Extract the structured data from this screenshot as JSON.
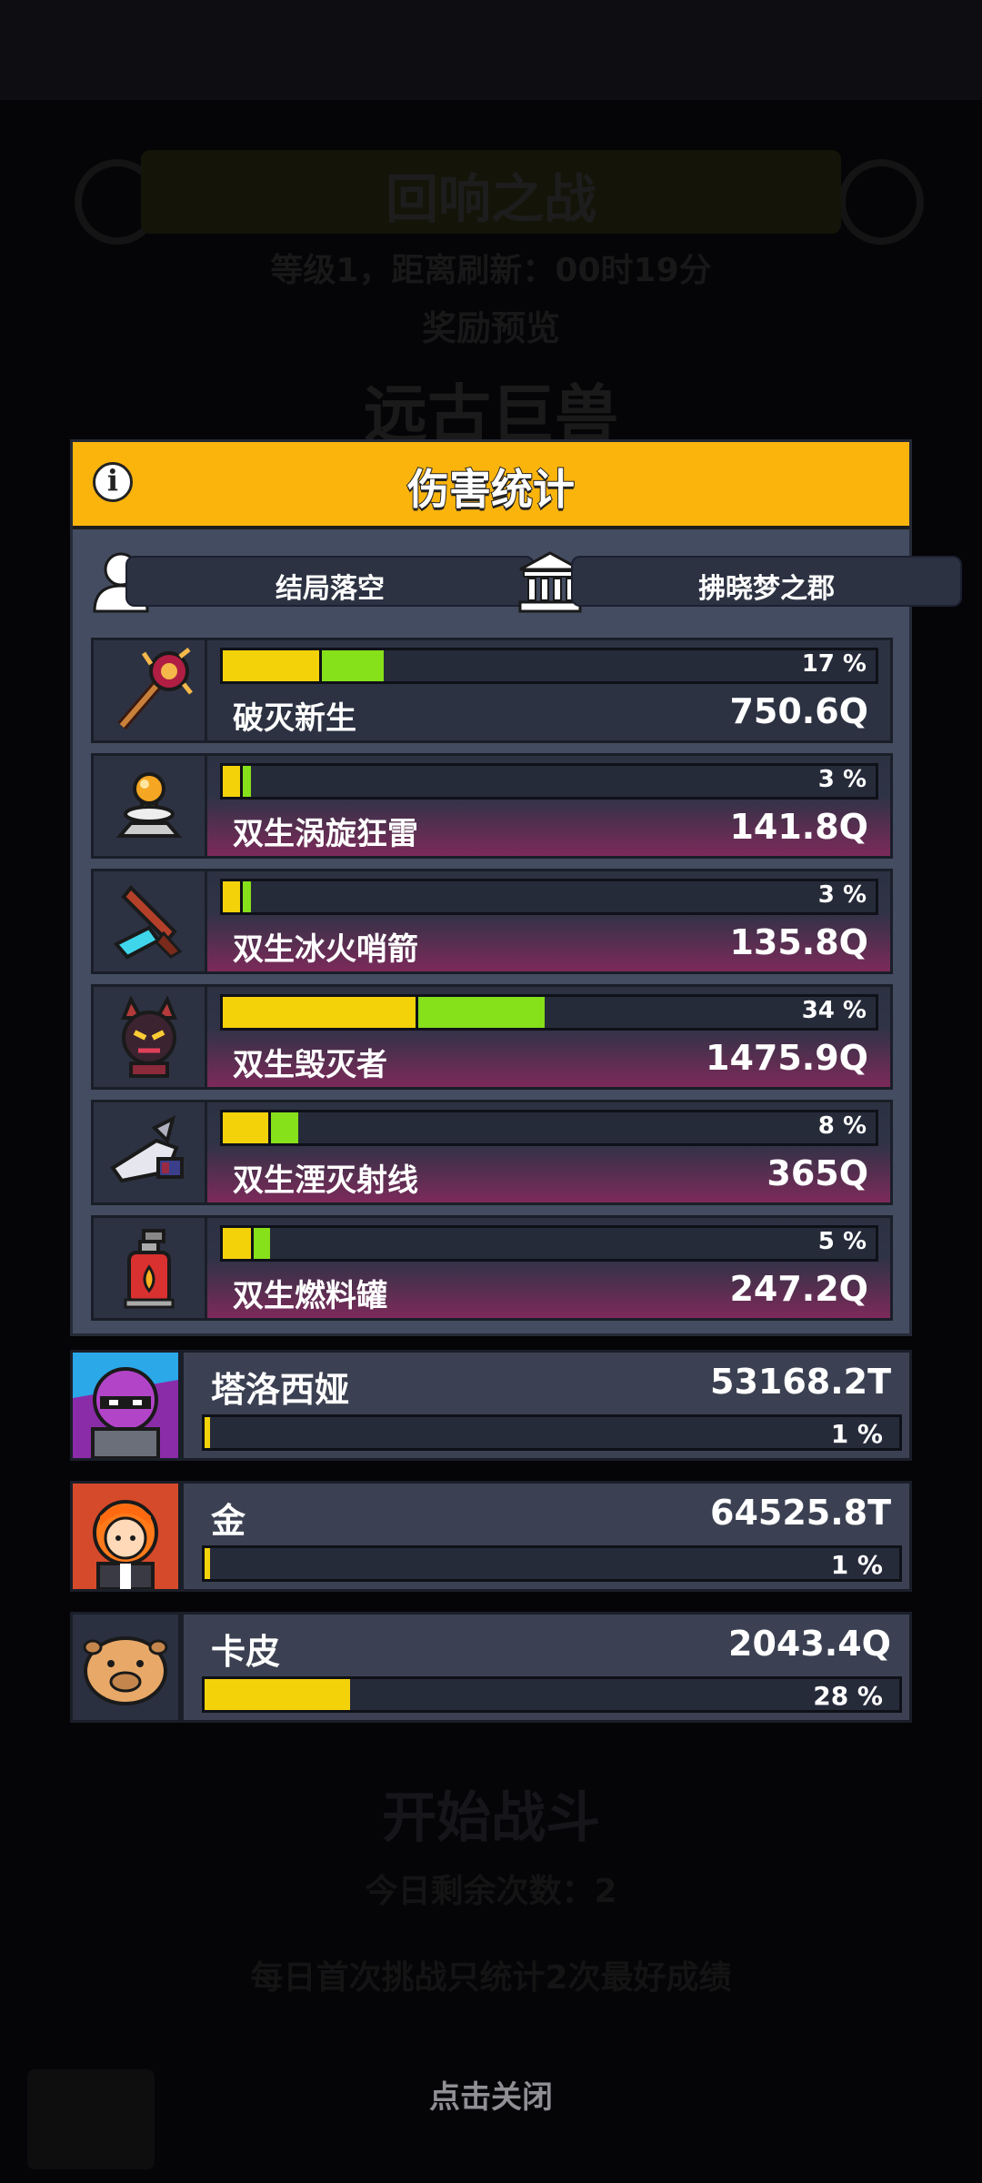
{
  "background": {
    "title": "回响之战",
    "sub": "等级1，距离刷新：00时19分",
    "sub2": "奖励预览",
    "big": "远古巨兽",
    "start_label": "开始战斗",
    "remaining": "今日剩余次数：2",
    "tip": "每日首次挑战只统计2次最好成绩"
  },
  "panel": {
    "title": "伤害统计",
    "player_name": "结局落空",
    "guild_name": "拂晓梦之郡"
  },
  "skills": [
    {
      "name": "破灭新生",
      "value": "750.6Q",
      "percent_label": "17 %",
      "percent": 17,
      "icon": "scepter-icon"
    },
    {
      "name": "双生涡旋狂雷",
      "value": "141.8Q",
      "percent_label": "3 %",
      "percent": 3,
      "icon": "tesla-orb-icon"
    },
    {
      "name": "双生冰火哨箭",
      "value": "135.8Q",
      "percent_label": "3 %",
      "percent": 3,
      "icon": "ice-fire-dart-icon"
    },
    {
      "name": "双生毁灭者",
      "value": "1475.9Q",
      "percent_label": "34 %",
      "percent": 34,
      "icon": "destroyer-demon-icon"
    },
    {
      "name": "双生湮灭射线",
      "value": "365Q",
      "percent_label": "8 %",
      "percent": 8,
      "icon": "ray-drone-icon"
    },
    {
      "name": "双生燃料罐",
      "value": "247.2Q",
      "percent_label": "5 %",
      "percent": 5,
      "icon": "fuel-canister-icon"
    }
  ],
  "heroes": [
    {
      "name": "塔洛西娅",
      "value": "53168.2T",
      "percent_label": "1 %",
      "percent": 1,
      "icon": "ninja-hero-icon"
    },
    {
      "name": "金",
      "value": "64525.8T",
      "percent_label": "1 %",
      "percent": 1,
      "icon": "redhair-hero-icon"
    },
    {
      "name": "卡皮",
      "value": "2043.4Q",
      "percent_label": "28 %",
      "percent": 28,
      "icon": "capybara-hero-icon"
    }
  ],
  "close_hint": "点击关闭",
  "colors": {
    "header": "#fbb40c",
    "bar_yellow": "#f4d20a",
    "bar_green": "#86e01a",
    "panel": "#434c60"
  }
}
